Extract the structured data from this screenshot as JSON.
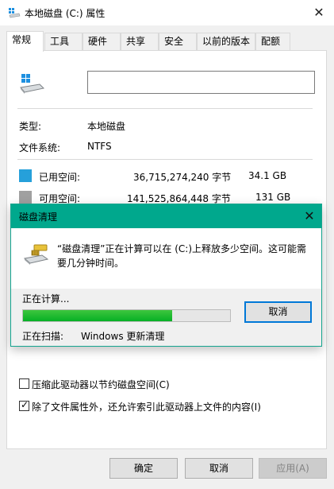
{
  "window": {
    "title": "本地磁盘 (C:) 属性",
    "close_glyph": "✕"
  },
  "tabs": [
    {
      "label": "常规",
      "active": true
    },
    {
      "label": "工具",
      "active": false
    },
    {
      "label": "硬件",
      "active": false
    },
    {
      "label": "共享",
      "active": false
    },
    {
      "label": "安全",
      "active": false
    },
    {
      "label": "以前的版本",
      "active": false
    },
    {
      "label": "配额",
      "active": false
    }
  ],
  "general": {
    "drive_name_value": "",
    "type_label": "类型:",
    "type_value": "本地磁盘",
    "fs_label": "文件系统:",
    "fs_value": "NTFS",
    "used": {
      "label": "已用空间:",
      "bytes": "36,715,274,240 字节",
      "size": "34.1 GB",
      "color": "#26a0da"
    },
    "free": {
      "label": "可用空间:",
      "bytes": "141,525,864,448 字节",
      "size": "131 GB",
      "color": "#a0a0a0"
    }
  },
  "options": [
    {
      "label": "压缩此驱动器以节约磁盘空间(C)",
      "checked": false
    },
    {
      "label": "除了文件属性外，还允许索引此驱动器上文件的内容(I)",
      "checked": true
    }
  ],
  "buttons": {
    "ok": "确定",
    "cancel": "取消",
    "apply": "应用(A)"
  },
  "dialog": {
    "title": "磁盘清理",
    "close_glyph": "✕",
    "message": "“磁盘清理”正在计算可以在 (C:)上释放多少空间。这可能需要几分钟时间。",
    "status": "正在计算...",
    "progress": 0.72,
    "scanning_label": "正在扫描:",
    "scanning_item": "Windows 更新清理",
    "cancel": "取消",
    "accent": "#00a88d"
  }
}
